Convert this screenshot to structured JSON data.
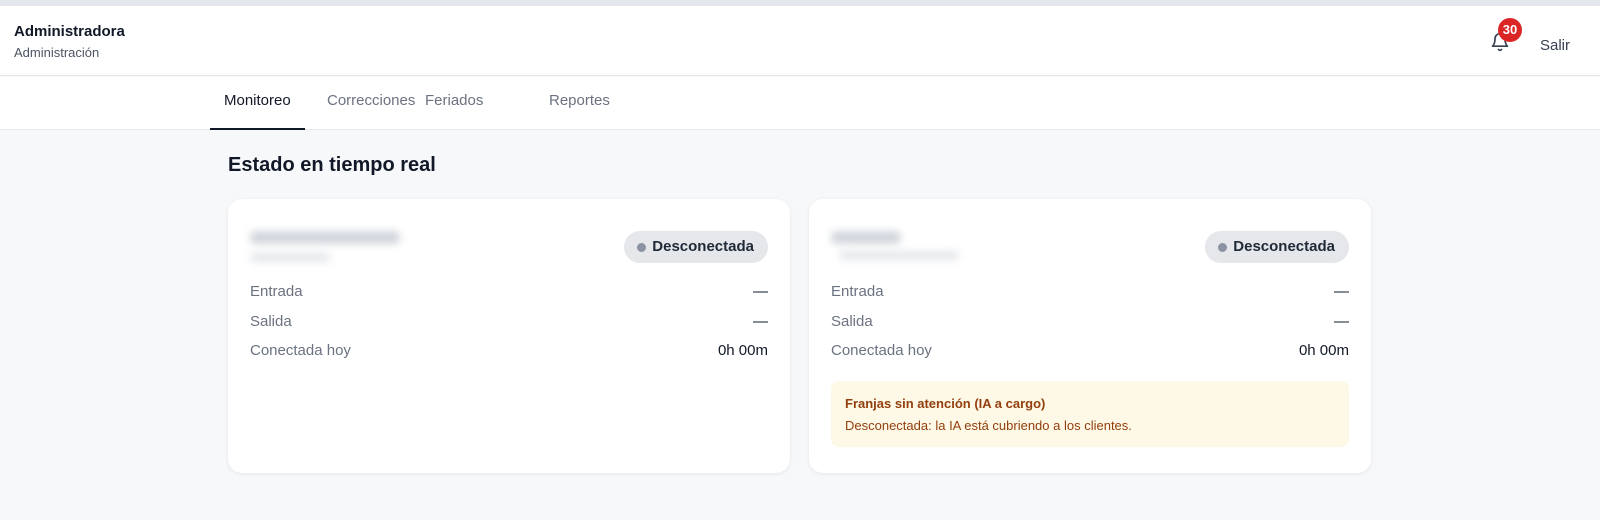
{
  "header": {
    "user_name": "Administradora",
    "user_role": "Administración",
    "notifications_count": "30",
    "notifications_icon": "bell-icon",
    "logout_label": "Salir"
  },
  "tabs": [
    {
      "label": "Monitoreo",
      "active": true
    },
    {
      "label": "Correcciones",
      "active": false
    },
    {
      "label": "Feriados",
      "active": false
    },
    {
      "label": "Reportes",
      "active": false
    }
  ],
  "section_title": "Estado en tiempo real",
  "cards": [
    {
      "status": "Desconectada",
      "rows": [
        {
          "label": "Entrada",
          "value": "—"
        },
        {
          "label": "Salida",
          "value": "—"
        },
        {
          "label": "Conectada hoy",
          "value": "0h 00m"
        }
      ]
    },
    {
      "status": "Desconectada",
      "rows": [
        {
          "label": "Entrada",
          "value": "—"
        },
        {
          "label": "Salida",
          "value": "—"
        },
        {
          "label": "Conectada hoy",
          "value": "0h 00m"
        }
      ],
      "notice": {
        "title": "Franjas sin atención (IA a cargo)",
        "text": "Desconectada: la IA está cubriendo a los clientes."
      }
    }
  ],
  "colors": {
    "accent": "#111827",
    "badge": "#dc2626",
    "status_dot": "#8b93a3",
    "notice_bg": "#fef8e7",
    "notice_text": "#92400e"
  }
}
